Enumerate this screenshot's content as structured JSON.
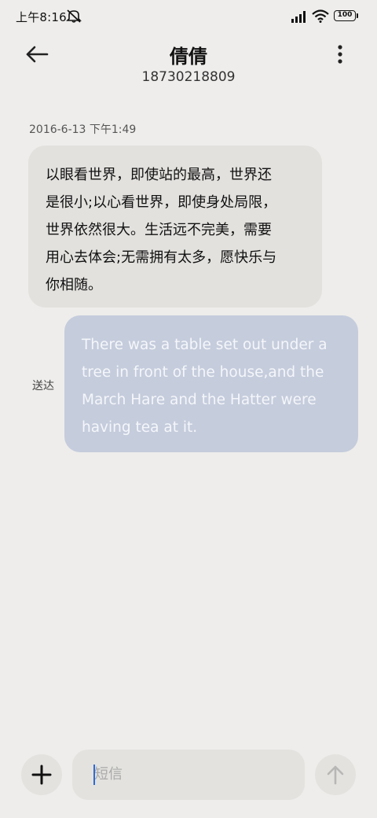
{
  "status_bar": {
    "time": "上午8:16",
    "battery": "100"
  },
  "header": {
    "contact_name": "倩倩",
    "contact_number": "18730218809"
  },
  "conversation": {
    "timestamp": "2016-6-13 下午1:49",
    "messages": [
      {
        "direction": "incoming",
        "lines": [
          "以眼看世界，即使站的最高，世界还",
          "是很小;以心看世界，即使身处局限，",
          "世界依然很大。生活远不完美，需要",
          "用心去体会;无需拥有太多，愿快乐与",
          "你相随。"
        ]
      },
      {
        "direction": "outgoing",
        "lines": [
          "There was a table set out under a",
          "tree in front of the house,and the",
          "March Hare and the Hatter were",
          "having tea at it."
        ],
        "status": "送达"
      }
    ]
  },
  "composer": {
    "placeholder": "短信"
  },
  "icons": {
    "back": "arrow-left-icon",
    "more": "more-vertical-icon",
    "add": "plus-icon",
    "send": "arrow-up-icon",
    "mute": "mute-icon",
    "signal": "signal-icon",
    "wifi": "wifi-icon"
  },
  "colors": {
    "background": "#eeedeb",
    "incoming_bubble": "#e2e1de",
    "outgoing_bubble": "#c5ccdc",
    "caret": "#2d6ad6"
  }
}
